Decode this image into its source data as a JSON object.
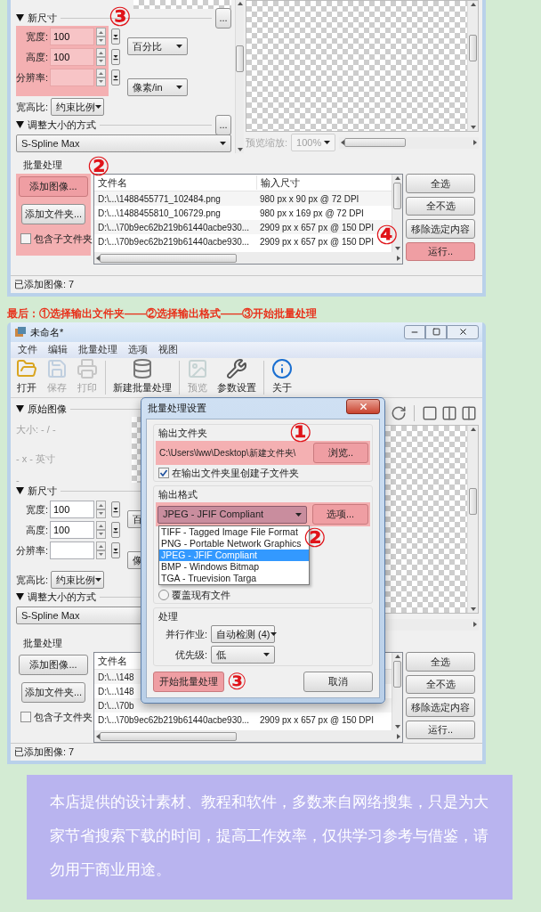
{
  "tutorial_step": {
    "new_size": {
      "title": "新尺寸",
      "more_button": "...",
      "highlighted": true,
      "marker": "③",
      "fields": [
        {
          "label": "宽度:",
          "value": "100"
        },
        {
          "label": "高度:",
          "value": "100"
        },
        {
          "label": "分辨率:"
        }
      ],
      "units": [
        "百分比",
        "像素/in"
      ],
      "aspect_label": "宽高比:",
      "aspect": "约束比例"
    },
    "resize": {
      "title": "调整大小的方式",
      "more_button": "...",
      "method": "S-Spline Max"
    },
    "preview_zoom": {
      "label": "预览缩放:",
      "value": "100%",
      "disabled": true
    },
    "batch": {
      "title": "批量处理",
      "add_buttons": [
        "添加图像...",
        "添加文件夹..."
      ],
      "highlighted": true,
      "marker": "②",
      "include_subfolders": {
        "label": "包含子文件夹",
        "checked": false
      },
      "columns": [
        "文件名",
        "输入尺寸"
      ],
      "rows": [
        [
          "D:\\...\\1488455771_102484.png",
          "980 px x 90 px @ 72 DPI"
        ],
        [
          "D:\\...\\1488455810_106729.png",
          "980 px x 169 px @ 72 DPI"
        ],
        [
          "D:\\...\\70b9ec62b219b61440acbe930...",
          "2909 px x 657 px @ 150 DPI"
        ],
        [
          "D:\\...\\70b9ec62b219b61440acbe930...",
          "2909 px x 657 px @ 150 DPI"
        ]
      ],
      "actions": [
        {
          "label": "全选",
          "highlighted": false
        },
        {
          "label": "全不选",
          "highlighted": false
        },
        {
          "label": "移除选定内容",
          "highlighted": false
        },
        {
          "label": "运行..",
          "highlighted": true,
          "marker": "④"
        }
      ]
    },
    "status": "已添加图像: 7"
  },
  "caption": "最后：①选择输出文件夹——②选择输出格式——③开始批量处理",
  "window": {
    "title": "未命名*",
    "menu": [
      "文件",
      "编辑",
      "批量处理",
      "选项",
      "视图"
    ],
    "toolbar": [
      {
        "label": "打开",
        "disabled": false
      },
      {
        "label": "保存",
        "disabled": true
      },
      {
        "label": "打印",
        "disabled": true
      },
      {
        "label": "新建批量处理",
        "disabled": false
      },
      {
        "label": "预览",
        "disabled": true
      },
      {
        "label": "参数设置",
        "disabled": false
      },
      {
        "label": "关于",
        "disabled": false
      }
    ],
    "original": {
      "title": "原始图像",
      "size": "大小: - / -",
      "inches": "- x - 英寸",
      "resolution": "-"
    },
    "new_size": {
      "title": "新尺寸",
      "highlighted": false,
      "fields": [
        {
          "label": "宽度:",
          "value": "100"
        },
        {
          "label": "高度:",
          "value": "100"
        },
        {
          "label": "分辨率:"
        }
      ],
      "units": [
        "百",
        "像"
      ],
      "aspect_label": "宽高比:",
      "aspect": "约束比例"
    },
    "resize": {
      "title": "调整大小的方式",
      "method": "S-Spline Max"
    },
    "batch": {
      "title": "批量处理",
      "add_buttons": [
        "添加图像...",
        "添加文件夹..."
      ],
      "highlighted": false,
      "include_subfolders": {
        "label": "包含子文件夹",
        "checked": false
      },
      "columns": [
        "文件名"
      ],
      "rows": [
        [
          "D:\\...\\148"
        ],
        [
          "D:\\...\\148"
        ],
        [
          "D:\\...\\70b"
        ],
        [
          "D:\\...\\70b9ec62b219b61440acbe930...",
          "2909 px x 657 px @ 150 DPI"
        ]
      ],
      "actions": [
        {
          "label": "全选",
          "highlighted": false
        },
        {
          "label": "全不选",
          "highlighted": false
        },
        {
          "label": "移除选定内容",
          "highlighted": false
        },
        {
          "label": "运行..",
          "highlighted": false
        }
      ]
    },
    "status": "已添加图像: 7",
    "dialog": {
      "title": "批量处理设置",
      "output_folder": {
        "title": "输出文件夹",
        "path": "C:\\Users\\lww\\Desktop\\新建文件夹\\",
        "browse": "浏览..",
        "highlighted": true,
        "marker": "①",
        "create_subfolder": {
          "label": "在输出文件夹里创建子文件夹",
          "checked": true
        }
      },
      "output_format": {
        "title": "输出格式",
        "value": "JPEG - JFIF Compliant",
        "options_button": "选项...",
        "highlighted": true,
        "marker": "②",
        "options": [
          {
            "label": "TIFF - Tagged Image File Format",
            "selected": false
          },
          {
            "label": "PNG - Portable Network Graphics",
            "selected": false
          },
          {
            "label": "JPEG - JFIF Compliant",
            "selected": true
          },
          {
            "label": "BMP - Windows Bitmap",
            "selected": false
          },
          {
            "label": "TGA - Truevision Targa",
            "selected": false
          }
        ]
      },
      "overwrite": {
        "label": "覆盖现有文件",
        "selected": false
      },
      "processing": {
        "title": "处理",
        "rows": [
          {
            "label": "并行作业:",
            "value": "自动检测 (4)"
          },
          {
            "label": "优先级:",
            "value": "低"
          }
        ]
      },
      "start": {
        "label": "开始批量处理",
        "highlighted": true,
        "marker": "③"
      },
      "cancel": "取消"
    }
  },
  "notice": "本店提供的设计素材、教程和软件，多数来自网络搜集，只是为大家节省搜索下载的时间，提高工作效率，仅供学习参考与借鉴，请勿用于商业用途。"
}
